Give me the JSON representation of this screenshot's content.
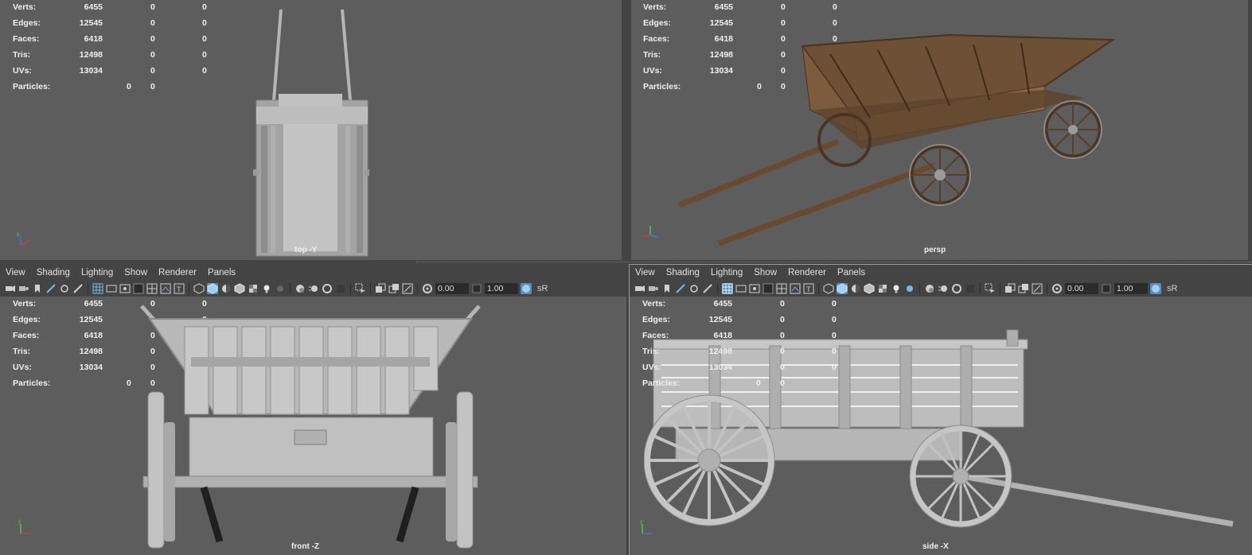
{
  "hud": {
    "verts_label": "Verts:",
    "verts": "6455",
    "edges_label": "Edges:",
    "edges": "12545",
    "faces_label": "Faces:",
    "faces": "6418",
    "tris_label": "Tris:",
    "tris": "12498",
    "uvs_label": "UVs:",
    "uvs": "13034",
    "particles_label": "Particles:",
    "zero": "0"
  },
  "viewports": {
    "top": {
      "camera": "top -Y"
    },
    "persp": {
      "camera": "persp"
    },
    "front": {
      "camera": "front -Z"
    },
    "side": {
      "camera": "side -X"
    }
  },
  "menu": [
    "View",
    "Shading",
    "Lighting",
    "Show",
    "Renderer",
    "Panels"
  ],
  "toolbar": {
    "field1": "0.00",
    "field2": "1.00",
    "srgb": "sR"
  },
  "axis": {
    "y": "y",
    "x": "x",
    "z": "z"
  },
  "colors": {
    "viewport_bg": "#5d5d5d",
    "ui_bg": "#444444",
    "active": "#5a8eb8"
  }
}
